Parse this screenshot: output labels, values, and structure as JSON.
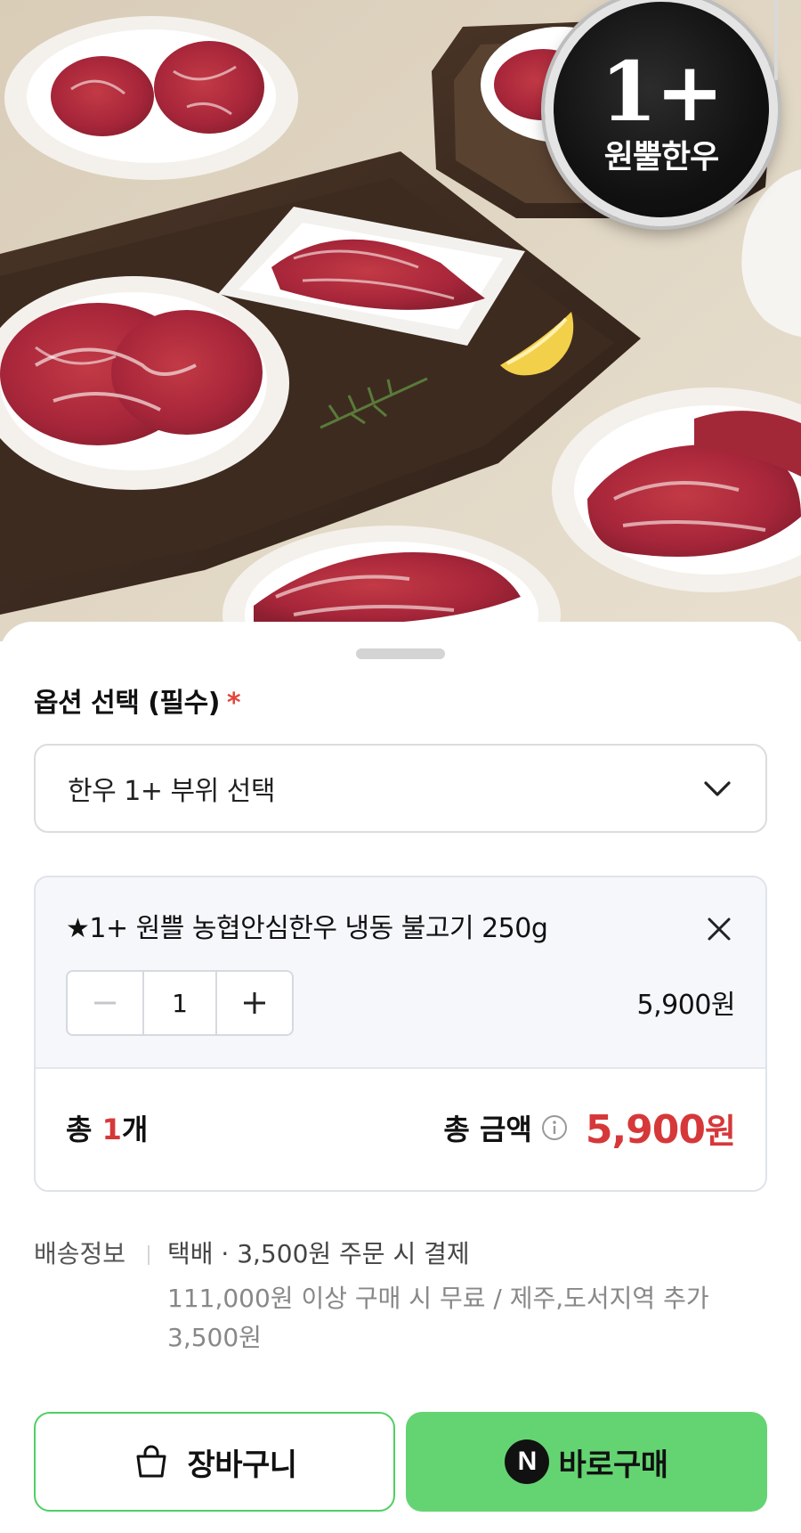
{
  "hero": {
    "badge_grade": "1+",
    "badge_label": "원뿔한우"
  },
  "option": {
    "heading": "옵션 선택 (필수)",
    "required_mark": "*",
    "select_value": "한우 1+ 부위 선택"
  },
  "order_item": {
    "name": "★1+ 원쁠 농협안심한우 냉동 불고기 250g",
    "quantity": "1",
    "price": "5,900원"
  },
  "total": {
    "count_prefix": "총 ",
    "count_value": "1",
    "count_suffix": "개",
    "amount_label": "총 금액",
    "amount_value": "5,900",
    "amount_unit": "원"
  },
  "delivery": {
    "label": "배송정보",
    "main": "택배 · 3,500원 주문 시 결제",
    "note": "111,000원 이상 구매 시 무료 / 제주,도서지역 추가 3,500원"
  },
  "actions": {
    "cart_label": "장바구니",
    "buy_label": "바로구매",
    "naver_glyph": "N"
  },
  "colors": {
    "accent_red": "#d6383a",
    "naver_green": "#64d472",
    "required_red": "#e4453a"
  }
}
